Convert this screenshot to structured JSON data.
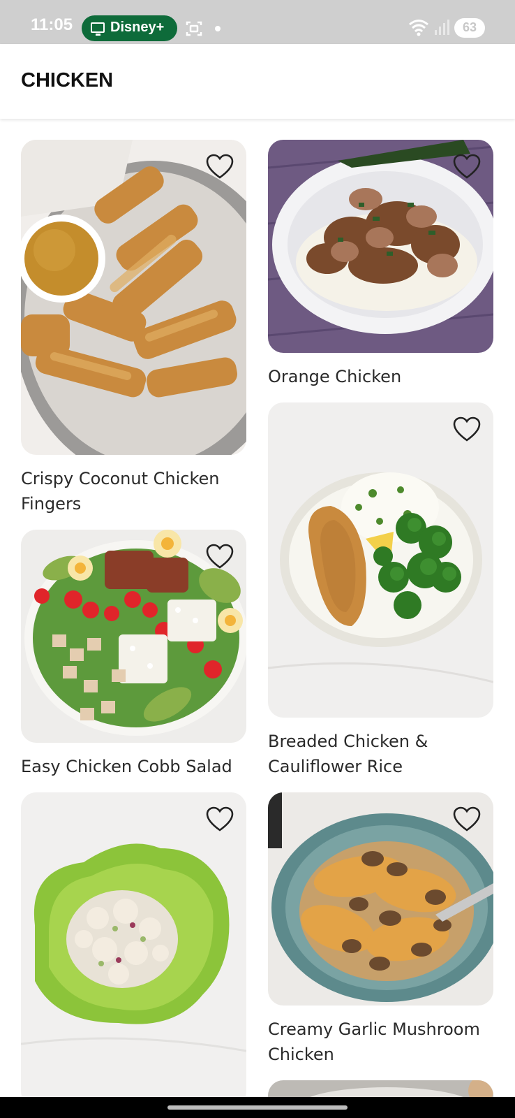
{
  "status_bar": {
    "time": "11:05",
    "app_badge": "Disney+",
    "battery": "63"
  },
  "header": {
    "title": "CHICKEN"
  },
  "recipes": [
    {
      "title": "Crispy Coconut Chicken Fingers",
      "favorite_icon": "heart-outline-icon"
    },
    {
      "title": "Orange Chicken",
      "favorite_icon": "heart-outline-icon"
    },
    {
      "title": "Breaded Chicken & Cauliflower Rice",
      "favorite_icon": "heart-outline-icon"
    },
    {
      "title": "Easy Chicken Cobb Salad",
      "favorite_icon": "heart-outline-icon"
    },
    {
      "title": "",
      "favorite_icon": "heart-outline-icon"
    },
    {
      "title": "Creamy Garlic Mushroom Chicken",
      "favorite_icon": "heart-outline-icon"
    }
  ],
  "colors": {
    "status_bar_bg": "#cfcfcf",
    "disney_badge_bg": "#0e6b3a",
    "title_text": "#111111",
    "card_title_text": "#2a2a2a"
  }
}
